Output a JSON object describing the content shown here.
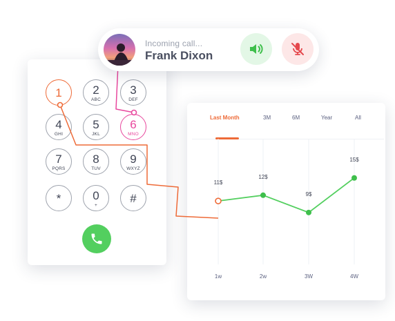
{
  "incoming_call": {
    "status": "Incoming call...",
    "caller_name": "Frank Dixon",
    "speaker_icon": "speaker-icon",
    "mute_icon": "mic-muted-icon"
  },
  "dialpad": {
    "keys": [
      {
        "digit": "1",
        "letters": ""
      },
      {
        "digit": "2",
        "letters": "ABC"
      },
      {
        "digit": "3",
        "letters": "DEF"
      },
      {
        "digit": "4",
        "letters": "GHI"
      },
      {
        "digit": "5",
        "letters": "JKL"
      },
      {
        "digit": "6",
        "letters": "MNO"
      },
      {
        "digit": "7",
        "letters": "PQRS"
      },
      {
        "digit": "8",
        "letters": "TUV"
      },
      {
        "digit": "9",
        "letters": "WXYZ"
      },
      {
        "digit": "*",
        "letters": ""
      },
      {
        "digit": "0",
        "letters": "+"
      },
      {
        "digit": "#",
        "letters": ""
      }
    ],
    "call_icon": "phone-icon"
  },
  "chart": {
    "tabs": [
      "Last Month",
      "3M",
      "6M",
      "Year",
      "All"
    ],
    "active_tab": "Last Month"
  },
  "colors": {
    "accent_orange": "#ee6a37",
    "accent_pink": "#e8479d",
    "line_green": "#53cf5f",
    "mute_red": "#e5484d"
  },
  "chart_data": {
    "type": "line",
    "categories": [
      "1w",
      "2w",
      "3W",
      "4W"
    ],
    "values": [
      11,
      12,
      9,
      15
    ],
    "data_labels": [
      "11$",
      "12$",
      "9$",
      "15$"
    ],
    "ylim": [
      0,
      20
    ]
  }
}
